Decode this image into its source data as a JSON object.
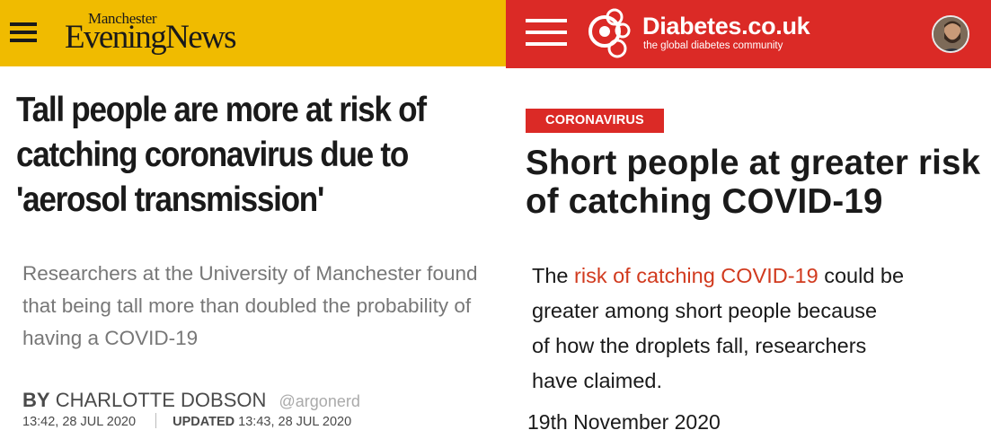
{
  "left_article": {
    "brand": {
      "top": "Manchester",
      "main": "EveningNews",
      "color": "#f0bb00"
    },
    "menu_icon": "hamburger-icon",
    "headline": "Tall people are more at risk of catching coronavirus due to 'aerosol transmission'",
    "standfirst": "Researchers at the University of Manchester found that being tall more than doubled the probability of having a COVID-19",
    "byline": {
      "by": "BY",
      "author": "CHARLOTTE DOBSON",
      "twitter": "@argonerd"
    },
    "published": "13:42, 28 JUL 2020",
    "updated_label": "UPDATED",
    "updated": "13:43, 28 JUL 2020"
  },
  "right_article": {
    "brand": {
      "name": "Diabetes.co.uk",
      "tagline": "the global diabetes community",
      "color": "#db2a26"
    },
    "menu_icon": "hamburger-icon",
    "avatar_icon": "user-avatar",
    "category": "CORONAVIRUS",
    "headline": "Short people at greater risk of catching COVID-19",
    "body": {
      "prefix": "The ",
      "link": "risk of catching COVID-19",
      "line1_rest": " could be",
      "line2": "greater among short people because",
      "line3": "of how the droplets fall, researchers",
      "line4": "have claimed."
    },
    "date": "19th November 2020",
    "link_color": "#d13a1e"
  }
}
